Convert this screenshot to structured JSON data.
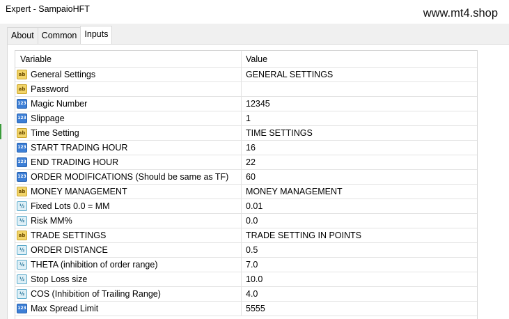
{
  "window": {
    "title": "Expert - SampaioHFT",
    "watermark": "www.mt4.shop"
  },
  "tabs": [
    {
      "label": "About",
      "active": false
    },
    {
      "label": "Common",
      "active": false
    },
    {
      "label": "Inputs",
      "active": true
    }
  ],
  "table": {
    "headers": {
      "variable": "Variable",
      "value": "Value"
    },
    "rows": [
      {
        "icon": "ab-string-icon",
        "variable": "General Settings",
        "value": "GENERAL SETTINGS"
      },
      {
        "icon": "ab-string-icon",
        "variable": "Password",
        "value": ""
      },
      {
        "icon": "123-integer-icon",
        "variable": "Magic Number",
        "value": "12345"
      },
      {
        "icon": "123-integer-icon",
        "variable": "Slippage",
        "value": "1"
      },
      {
        "icon": "ab-string-icon",
        "variable": "Time Setting",
        "value": "TIME SETTINGS"
      },
      {
        "icon": "123-integer-icon",
        "variable": "START TRADING HOUR",
        "value": "16"
      },
      {
        "icon": "123-integer-icon",
        "variable": "END TRADING HOUR",
        "value": "22"
      },
      {
        "icon": "123-integer-icon",
        "variable": "ORDER MODIFICATIONS (Should be same as TF)",
        "value": "60"
      },
      {
        "icon": "ab-string-icon",
        "variable": "MONEY MANAGEMENT",
        "value": "MONEY MANAGEMENT"
      },
      {
        "icon": "half-double-icon",
        "variable": "Fixed Lots 0.0 = MM",
        "value": "0.01"
      },
      {
        "icon": "half-double-icon",
        "variable": "Risk MM%",
        "value": "0.0"
      },
      {
        "icon": "ab-string-icon",
        "variable": "TRADE SETTINGS",
        "value": "TRADE SETTING IN POINTS"
      },
      {
        "icon": "half-double-icon",
        "variable": "ORDER DISTANCE",
        "value": "0.5"
      },
      {
        "icon": "half-double-icon",
        "variable": "THETA (inhibition of order range)",
        "value": "7.0"
      },
      {
        "icon": "half-double-icon",
        "variable": "Stop Loss size",
        "value": "10.0"
      },
      {
        "icon": "half-double-icon",
        "variable": "COS (Inhibition of Trailing Range)",
        "value": "4.0"
      },
      {
        "icon": "123-integer-icon",
        "variable": "Max Spread Limit",
        "value": "5555"
      }
    ]
  }
}
